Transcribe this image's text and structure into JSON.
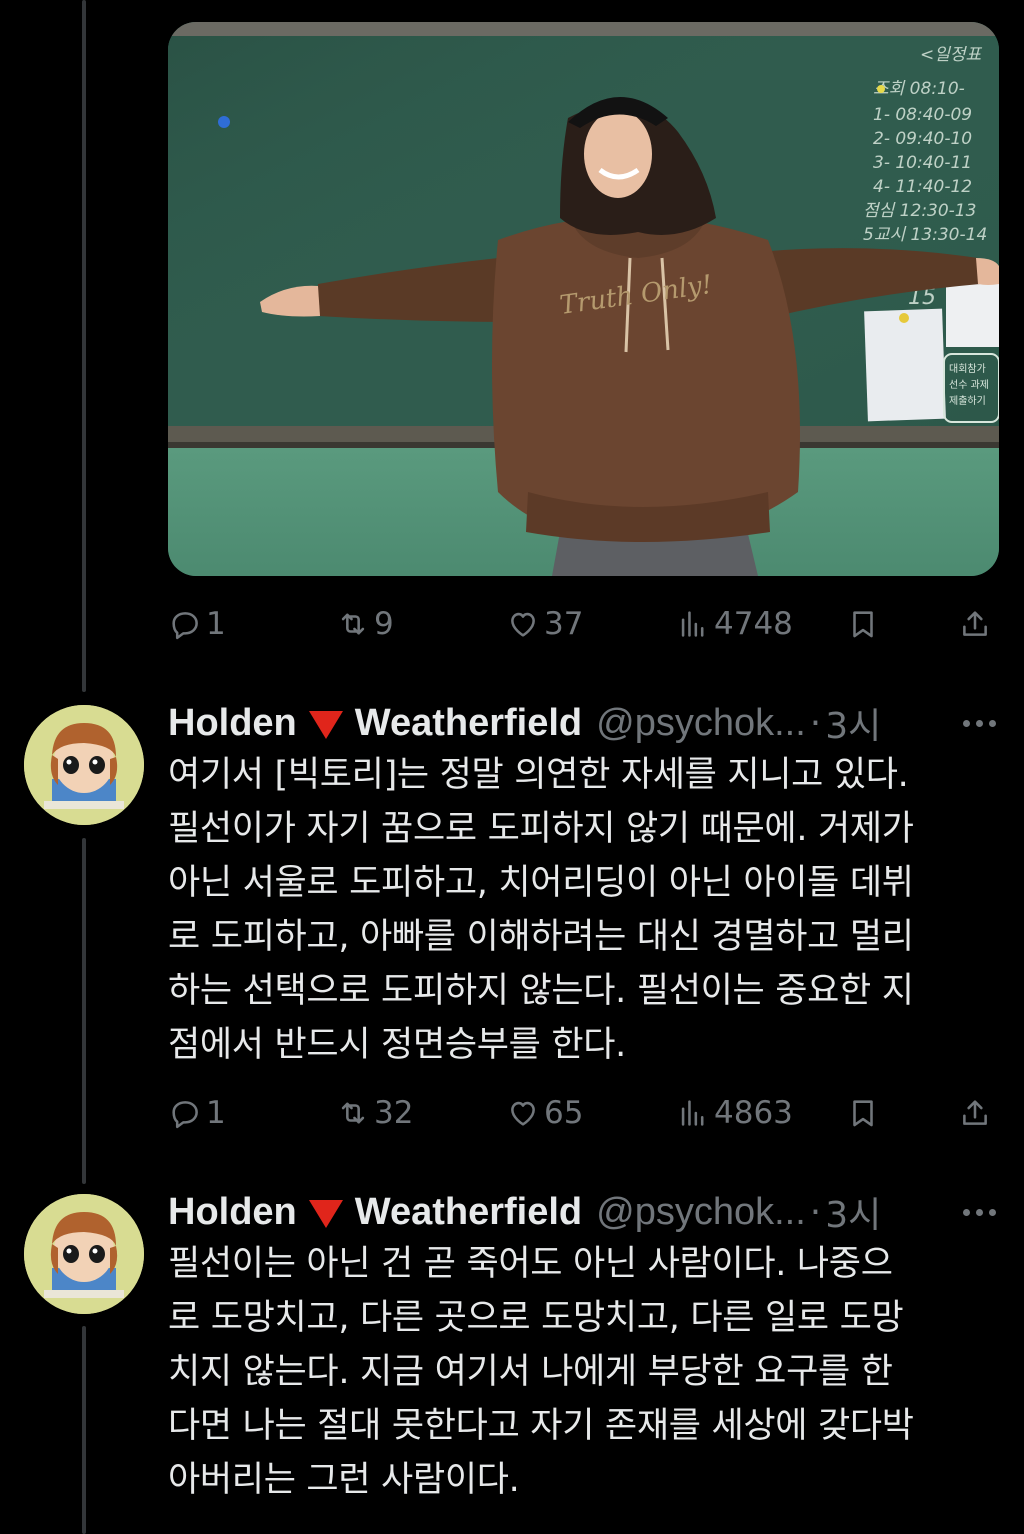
{
  "tweets": [
    {
      "actions": {
        "replies": "1",
        "retweets": "9",
        "likes": "37",
        "views": "4748"
      }
    },
    {
      "author": {
        "name_first": "Holden",
        "name_last": "Weatherfield",
        "emoji_icon": "red-triangle-icon",
        "handle": "@psychok...",
        "dot": "·",
        "time": "3시"
      },
      "text": "여기서 [빅토리]는 정말 의연한 자세를 지니고 있다.\n필선이가 자기 꿈으로 도피하지 않기 때문에. 거제가\n아닌 서울로 도피하고, 치어리딩이 아닌 아이돌 데뷔\n로 도피하고, 아빠를 이해하려는 대신 경멸하고 멀리\n하는 선택으로 도피하지 않는다. 필선이는 중요한 지\n점에서 반드시 정면승부를 한다.",
      "actions": {
        "replies": "1",
        "retweets": "32",
        "likes": "65",
        "views": "4863"
      }
    },
    {
      "author": {
        "name_first": "Holden",
        "name_last": "Weatherfield",
        "emoji_icon": "red-triangle-icon",
        "handle": "@psychok...",
        "dot": "·",
        "time": "3시"
      },
      "text": "필선이는 아닌 건 곧 죽어도 아닌 사람이다. 나중으\n로 도망치고, 다른 곳으로 도망치고, 다른 일로 도망\n치지 않는다. 지금 여기서 나에게 부당한 요구를 한\n다면 나는 절대 못한다고 자기 존재를 세상에 갖다박\n아버리는 그런 사람이다."
    }
  ],
  "media": {
    "hoodie_text": "Truth Only!",
    "board_header": "<일정표",
    "board_lines": [
      "조회 08:10-",
      "1- 08:40-09",
      "2- 09:40-10",
      "3- 10:40-11",
      "4- 11:40-12",
      "점심 12:30-13",
      "5교시 13:30-14"
    ],
    "note_text": [
      "대회참가",
      "선수 과제",
      "제출하기"
    ],
    "board_number": "15"
  },
  "icons": {
    "reply": "reply-icon",
    "retweet": "retweet-icon",
    "like": "heart-icon",
    "views": "views-icon",
    "bookmark": "bookmark-icon",
    "share": "share-icon",
    "more": "more-icon"
  },
  "colors": {
    "background": "#000000",
    "text_primary": "#e7e9ea",
    "text_secondary": "#71767b",
    "thread_line": "#333639",
    "triangle": "#e0251b"
  }
}
